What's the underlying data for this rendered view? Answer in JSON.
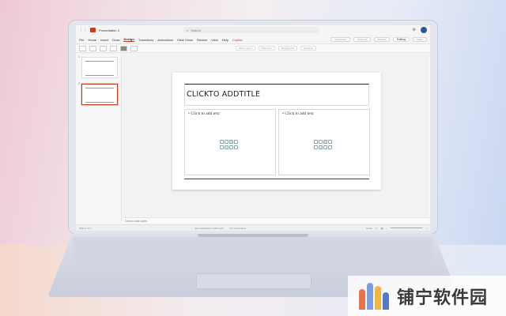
{
  "window": {
    "doc_title": "Presentation 3",
    "search_placeholder": "Search"
  },
  "menu": {
    "tabs": [
      {
        "label": "File"
      },
      {
        "label": "Home"
      },
      {
        "label": "Insert"
      },
      {
        "label": "Draw"
      },
      {
        "label": "Design",
        "active": true
      },
      {
        "label": "Transitions"
      },
      {
        "label": "Animations"
      },
      {
        "label": "Slide Show"
      },
      {
        "label": "Review"
      },
      {
        "label": "View"
      },
      {
        "label": "Help"
      },
      {
        "label": "Copilot",
        "accent": true
      }
    ],
    "editing_label": "Editing",
    "right_buttons": [
      "Comments",
      "Catch up",
      "Present",
      "Share"
    ]
  },
  "ribbon": {
    "designer_label": "Designer",
    "items": [
      "Slide Layout",
      "Slide Size",
      "Background",
      "Designer"
    ]
  },
  "thumbnails": [
    {
      "number": "1"
    },
    {
      "number": "2",
      "selected": true
    }
  ],
  "slide": {
    "title": "CLICKTO ADDTITLE",
    "left_bullet": "Click to add text",
    "right_bullet": "Click to add text"
  },
  "notes": {
    "placeholder": "Click to add notes"
  },
  "status": {
    "slide_info": "Slide 2 of 2",
    "feedback": "Give Feedback to Microsoft",
    "connection": "Not Connected",
    "notes_label": "Notes"
  },
  "brand": {
    "text": "铺宁软件园",
    "colors": [
      "#e8724a",
      "#7c9ee0",
      "#f2b441",
      "#5a78c8"
    ]
  }
}
